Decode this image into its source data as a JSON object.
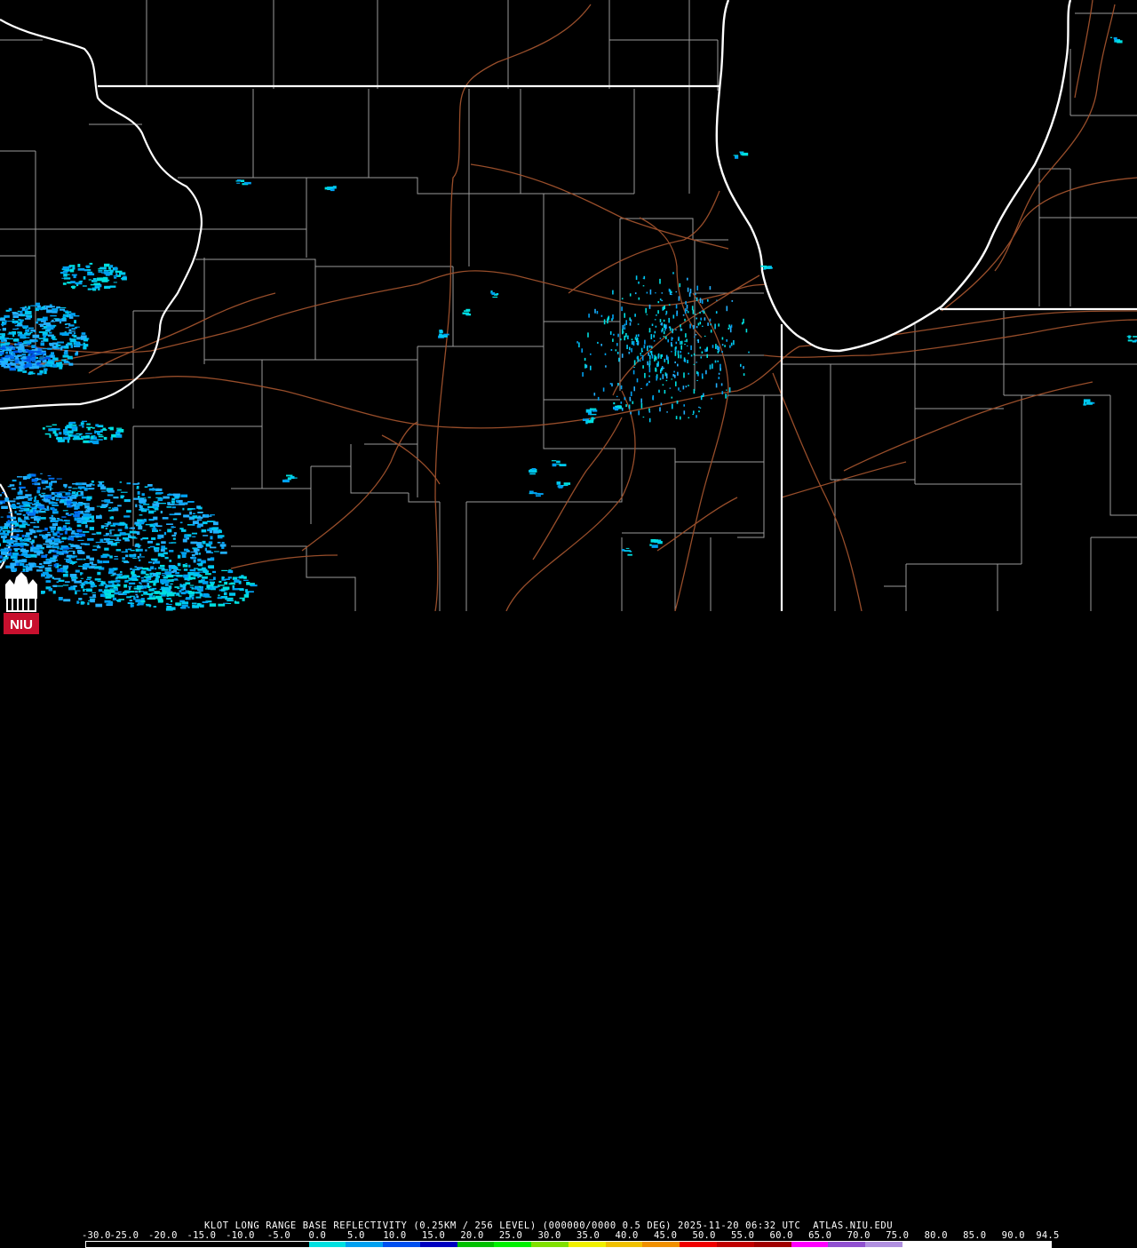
{
  "header": {
    "title": "KLOT LONG RANGE BASE REFLECTIVITY (0.25KM / 256 LEVEL) (000000/0000 0.5 DEG) 2025-11-20 06:32 UTC  ATLAS.NIU.EDU"
  },
  "legend": {
    "ticks": [
      "-30.0",
      "-25.0",
      "-20.0",
      "-15.0",
      "-10.0",
      "-5.0",
      "0.0",
      "5.0",
      "10.0",
      "15.0",
      "20.0",
      "25.0",
      "30.0",
      "35.0",
      "40.0",
      "45.0",
      "50.0",
      "55.0",
      "60.0",
      "65.0",
      "70.0",
      "75.0",
      "80.0",
      "85.0",
      "90.0",
      "94.5"
    ],
    "colors": [
      "#000000",
      "#000000",
      "#000000",
      "#000000",
      "#000000",
      "#000000",
      "#00e0e0",
      "#00a0f0",
      "#0050f0",
      "#0000c0",
      "#00c000",
      "#00f000",
      "#80e000",
      "#f0f000",
      "#f0c000",
      "#f09000",
      "#f00000",
      "#c00000",
      "#a00000",
      "#ff00ff",
      "#9050d0",
      "#b090e0",
      "#ffffff",
      "#ffffff",
      "#ffffff",
      "#ffffff"
    ]
  },
  "logo": {
    "text": "NIU",
    "color": "#c8102e"
  },
  "map": {
    "state_border_color": "#ffffff",
    "county_border_color": "#9a9a9a",
    "highway_color": "#a0522d"
  }
}
